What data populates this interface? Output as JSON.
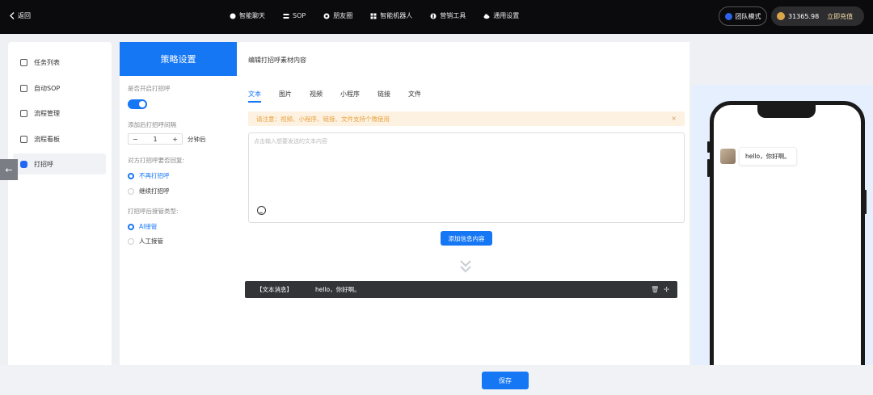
{
  "header": {
    "back_label": "返回",
    "nav": [
      {
        "label": "智能聊天",
        "icon": "chat-icon"
      },
      {
        "label": "SOP",
        "icon": "layers-icon"
      },
      {
        "label": "朋友圈",
        "icon": "moments-icon"
      },
      {
        "label": "智能机器人",
        "icon": "robot-icon"
      },
      {
        "label": "营销工具",
        "icon": "gift-icon"
      },
      {
        "label": "通用设置",
        "icon": "cloud-icon"
      }
    ],
    "team_mode_label": "团队模式",
    "balance": "31365.98",
    "recharge_label": "立即充值"
  },
  "sidebar": {
    "items": [
      {
        "label": "任务列表"
      },
      {
        "label": "自动SOP"
      },
      {
        "label": "流程管理"
      },
      {
        "label": "流程看板"
      },
      {
        "label": "打招呼"
      }
    ],
    "active_index": 4
  },
  "strategy": {
    "title": "策略设置",
    "enable_label": "是否开启打招呼",
    "enabled": true,
    "interval_label": "添加后打招呼间隔",
    "interval_value": "1",
    "interval_unit": "分钟后",
    "reply_label": "对方打招呼要否回复:",
    "reply_options": [
      "不再打招呼",
      "继续打招呼"
    ],
    "reply_selected": 0,
    "takeover_label": "打招呼后接管类型:",
    "takeover_options": [
      "AI接管",
      "人工接管"
    ],
    "takeover_selected": 0
  },
  "editor": {
    "title": "编辑打招呼素材内容",
    "tabs": [
      "文本",
      "图片",
      "视频",
      "小程序",
      "链接",
      "文件"
    ],
    "active_tab": 0,
    "notice": "请注意：视频、小程序、链接、文件支持个微使用",
    "textarea_placeholder": "点击输入想要发送的文本内容",
    "add_button": "添加信息内容",
    "message": {
      "tag": "【文本消息】",
      "text": "hello，你好啊。"
    }
  },
  "preview": {
    "bubble_text": "hello，你好啊。"
  },
  "footer": {
    "save_label": "保存"
  },
  "colors": {
    "primary": "#1677f5",
    "topbar": "#0b0b0d",
    "notice_bg": "#fdf1e1",
    "notice_text": "#e8a23c"
  }
}
